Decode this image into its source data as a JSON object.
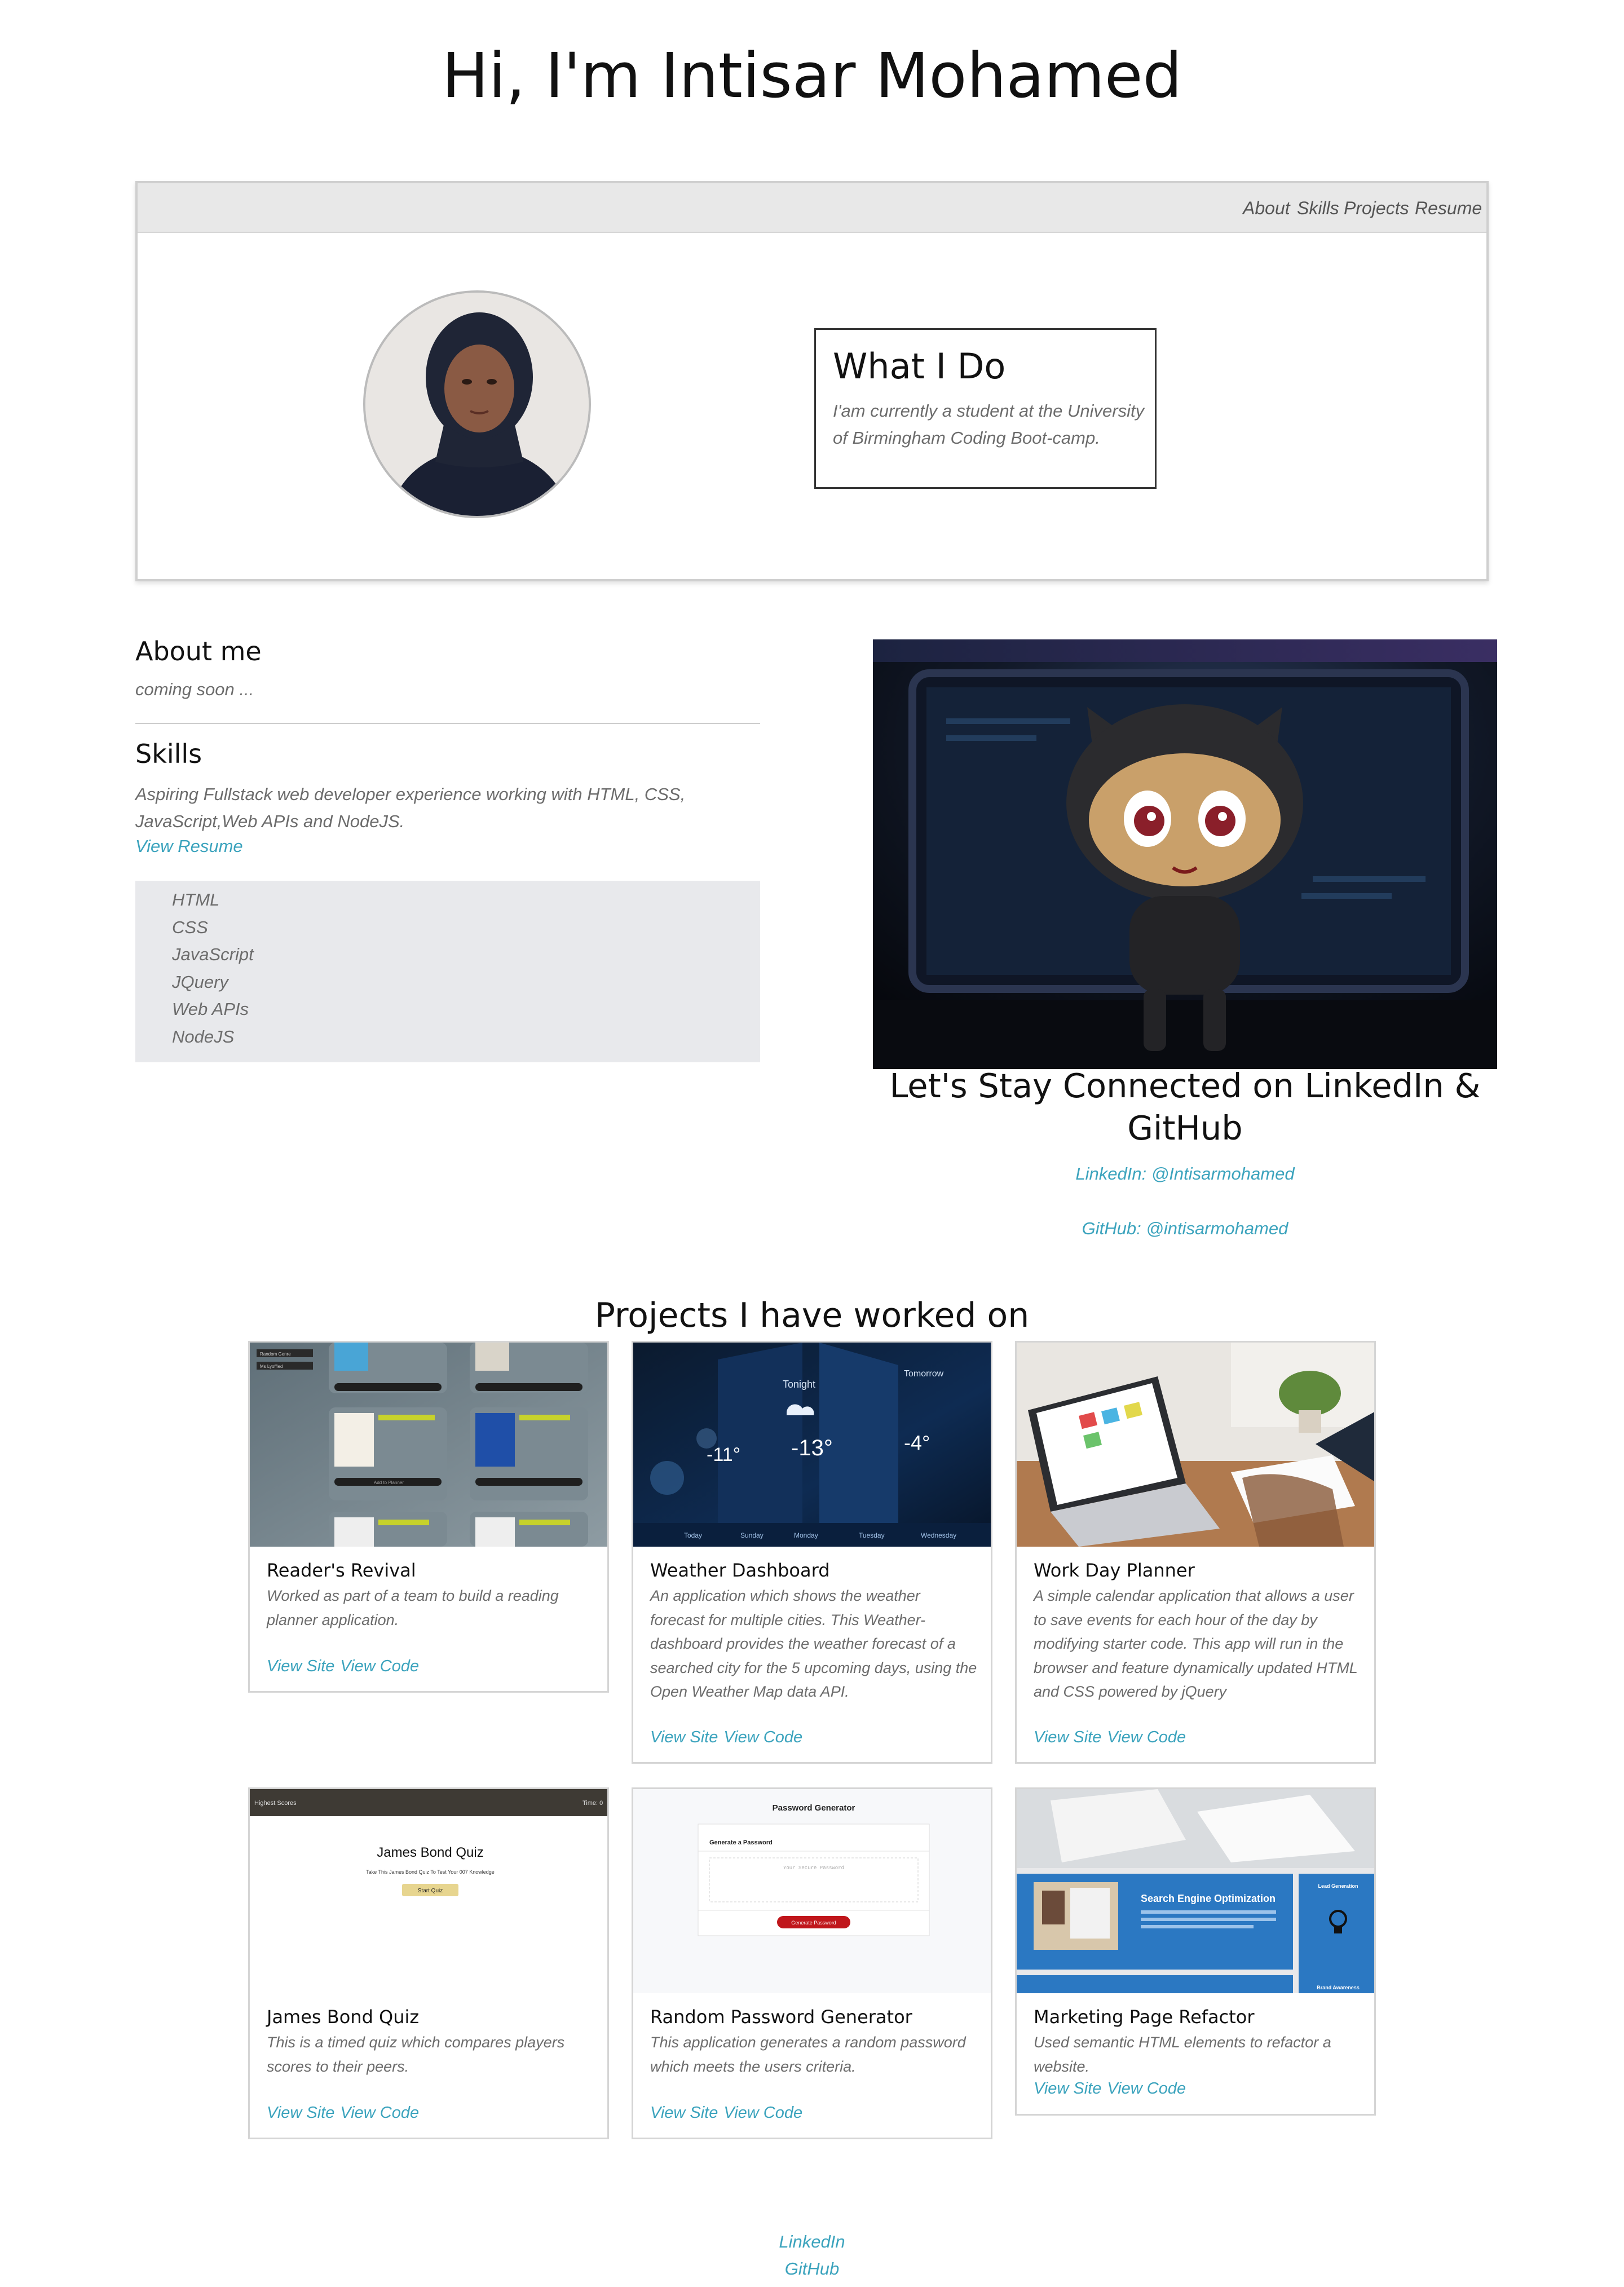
{
  "hero": {
    "title": "Hi, I'm Intisar Mohamed"
  },
  "nav": {
    "items": [
      "About",
      "Skills",
      "Projects",
      "Resume"
    ]
  },
  "what_i_do": {
    "title": "What I Do",
    "text": "I'am currently a student at the University of Birmingham Coding Boot-camp."
  },
  "about": {
    "title": "About me",
    "text": "coming soon ..."
  },
  "skills": {
    "title": "Skills",
    "text": "Aspiring Fullstack web developer experience working with HTML, CSS, JavaScript,Web APIs and NodeJS.",
    "resume_link": "View Resume",
    "list": [
      "HTML",
      "CSS",
      "JavaScript",
      "JQuery",
      "Web APIs",
      "NodeJS"
    ]
  },
  "connect": {
    "title": "Let's Stay Connected on LinkedIn & GitHub",
    "linkedin": "LinkedIn: @Intisarmohamed",
    "github": "GitHub: @intisarmohamed"
  },
  "projects": {
    "title": "Projects I have worked on",
    "items": [
      {
        "title": "Reader's Revival",
        "desc": "Worked as part of a team to build a reading planner application.",
        "site": "View Site",
        "code": "View Code"
      },
      {
        "title": "Weather Dashboard",
        "desc": "An application which shows the weather forecast for multiple cities. This Weather-dashboard provides the weather forecast of a searched city for the 5 upcoming days, using the Open Weather Map data API.",
        "site": "View Site",
        "code": "View Code"
      },
      {
        "title": "Work Day Planner",
        "desc": "A simple calendar application that allows a user to save events for each hour of the day by modifying starter code. This app will run in the browser and feature dynamically updated HTML and CSS powered by jQuery",
        "site": "View Site",
        "code": "View Code"
      },
      {
        "title": "James Bond Quiz",
        "desc": "This is a timed quiz which compares players scores to their peers.",
        "site": "View Site",
        "code": "View Code"
      },
      {
        "title": "Random Password Generator",
        "desc": "This application generates a random password which meets the users criteria.",
        "site": "View Site",
        "code": "View Code"
      },
      {
        "title": "Marketing Page Refactor",
        "desc": "Used semantic HTML elements to refactor a website.",
        "site": "View Site",
        "code": "View Code"
      }
    ]
  },
  "thumbnails": {
    "readers": {
      "tag1": "Random Genre",
      "tag2": "Ms Lyoffled",
      "btn": "Add to Planner"
    },
    "weather": {
      "tonight": "Tonight",
      "tomorrow": "Tomorrow",
      "t1": "-11°",
      "t2": "-13°",
      "t3": "-4°",
      "days": [
        "Today",
        "Sunday",
        "Monday",
        "Tuesday",
        "Wednesday"
      ]
    },
    "bond": {
      "header_left": "Highest Scores",
      "header_right": "Time: 0",
      "title": "James Bond Quiz",
      "sub": "Take This James Bond Quiz To Test Your 007 Knowledge",
      "btn": "Start Quiz"
    },
    "password": {
      "title": "Password Generator",
      "label": "Generate a Password",
      "placeholder": "Your Secure Password",
      "btn": "Generate Password"
    },
    "marketing": {
      "main": "Search Engine Optimization",
      "side": "Lead Generation",
      "bottom": "Brand Awareness"
    }
  },
  "footer": {
    "linkedin": "LinkedIn",
    "github": "GitHub"
  },
  "colors": {
    "link": "#3ba3bd",
    "nav_bg": "#e8e8e8",
    "skills_bg": "#e8e9ec",
    "card_border": "#d5d5d5"
  }
}
